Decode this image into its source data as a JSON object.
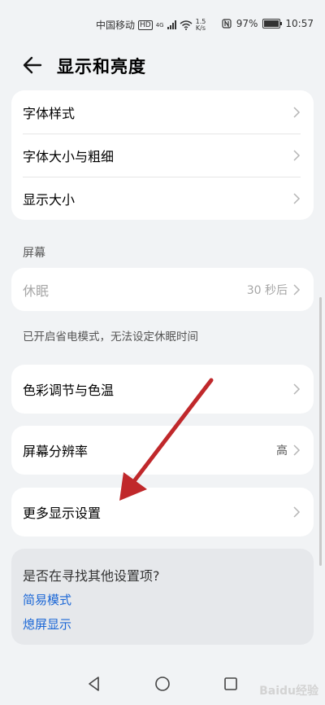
{
  "status_bar": {
    "carrier": "中国移动",
    "hd": "HD",
    "net": "4G",
    "speed_value": "1.5",
    "speed_unit": "K/s",
    "battery": "97%",
    "time": "10:57"
  },
  "header": {
    "title": "显示和亮度"
  },
  "font_group": [
    {
      "label": "字体样式"
    },
    {
      "label": "字体大小与粗细"
    },
    {
      "label": "显示大小"
    }
  ],
  "screen_section": {
    "label": "屏幕",
    "sleep_label": "休眠",
    "sleep_value": "30 秒后",
    "note": "已开启省电模式，无法设定休眠时间"
  },
  "color_temp": {
    "label": "色彩调节与色温"
  },
  "resolution": {
    "label": "屏幕分辨率",
    "value": "高"
  },
  "more_display": {
    "label": "更多显示设置"
  },
  "suggest": {
    "question": "是否在寻找其他设置项?",
    "link1": "简易模式",
    "link2": "熄屏显示"
  },
  "watermark": "Baidu经验",
  "colors": {
    "accent": "#1a66d6",
    "arrow": "#c0282b"
  }
}
